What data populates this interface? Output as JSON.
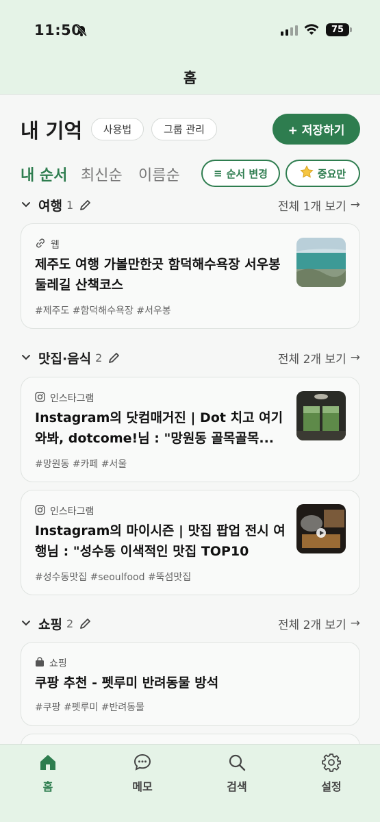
{
  "status": {
    "time": "11:50",
    "battery": "75"
  },
  "header": {
    "title": "홈"
  },
  "main": {
    "title": "내 기억",
    "how_to": "사용법",
    "group_manage": "그룹 관리",
    "save": "+ 저장하기"
  },
  "sort_tabs": [
    "내 순서",
    "최신순",
    "이름순"
  ],
  "actions": {
    "reorder": "순서 변경",
    "important": "중요만"
  },
  "groups": [
    {
      "name": "여행",
      "count": "1",
      "more": "전체 1개 보기",
      "cards": [
        {
          "source": "웹",
          "title": "제주도 여행 가볼만한곳 함덕해수욕장 서우봉 둘레길 산책코스",
          "tags": "#제주도 #함덕해수욕장 #서우봉"
        }
      ]
    },
    {
      "name": "맛집·음식",
      "count": "2",
      "more": "전체 2개 보기",
      "cards": [
        {
          "source": "인스타그램",
          "title": "Instagram의 닷컴매거진 | Dot 치고 여기 와봐, dotcome!님 : \"망원동 골목골목...",
          "tags": "#망원동 #카페 #서울"
        },
        {
          "source": "인스타그램",
          "title": "Instagram의 마이시즌 | 맛집 팝업 전시 여행님 : \"성수동 이색적인 맛집 TOP10",
          "tags": "#성수동맛집 #seoulfood #뚝섬맛집"
        }
      ]
    },
    {
      "name": "쇼핑",
      "count": "2",
      "more": "전체 2개 보기",
      "cards": [
        {
          "source": "쇼핑",
          "title": "쿠팡 추천 - 펫루미 반려동물 방석",
          "tags": "#쿠팡 #펫루미 #반려동물"
        }
      ]
    }
  ],
  "nav": [
    {
      "label": "홈",
      "icon": "home-icon"
    },
    {
      "label": "메모",
      "icon": "chat-icon"
    },
    {
      "label": "검색",
      "icon": "search-icon"
    },
    {
      "label": "설정",
      "icon": "gear-icon"
    }
  ],
  "colors": {
    "accent": "#2e7d4f",
    "header_bg": "#e5f3e7",
    "page_bg": "#f6f7f6"
  }
}
